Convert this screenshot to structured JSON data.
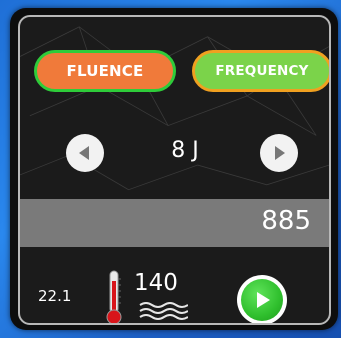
{
  "modes": {
    "fluence_label": "FLUENCE",
    "frequency_label": "FREQUENCY"
  },
  "energy": {
    "value_label": "8 J"
  },
  "value_bar": {
    "value": "885"
  },
  "status": {
    "temperature": "22.1",
    "water_level": "140"
  },
  "icons": {
    "left_arrow": "chevron-left-icon",
    "right_arrow": "chevron-right-icon",
    "thermometer": "thermometer-icon",
    "waves": "water-waves-icon",
    "play": "play-icon"
  },
  "colors": {
    "fluence_fill": "#f07a3a",
    "fluence_border": "#2ecc3a",
    "frequency_fill": "#7bd34a",
    "frequency_border": "#f0a020",
    "play_green": "#2fbf2d",
    "thermometer_red": "#d8141a"
  }
}
